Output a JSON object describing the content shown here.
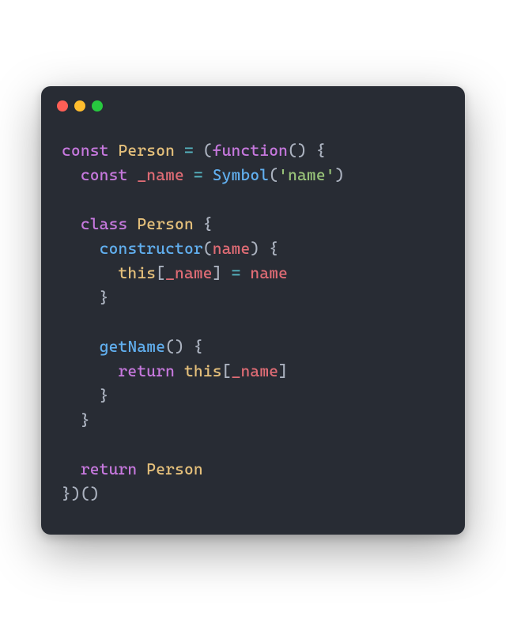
{
  "window": {
    "controls": {
      "close": "red",
      "minimize": "yellow",
      "zoom": "green"
    }
  },
  "code": {
    "tokens": [
      [
        {
          "t": "kw",
          "v": "const"
        },
        {
          "t": "pn",
          "v": " "
        },
        {
          "t": "cls",
          "v": "Person"
        },
        {
          "t": "pn",
          "v": " "
        },
        {
          "t": "op",
          "v": "="
        },
        {
          "t": "pn",
          "v": " ("
        },
        {
          "t": "kw",
          "v": "function"
        },
        {
          "t": "pn",
          "v": "() {"
        }
      ],
      [
        {
          "t": "pn",
          "v": "  "
        },
        {
          "t": "kw",
          "v": "const"
        },
        {
          "t": "pn",
          "v": " "
        },
        {
          "t": "var",
          "v": "_name"
        },
        {
          "t": "pn",
          "v": " "
        },
        {
          "t": "op",
          "v": "="
        },
        {
          "t": "pn",
          "v": " "
        },
        {
          "t": "fn",
          "v": "Symbol"
        },
        {
          "t": "pn",
          "v": "("
        },
        {
          "t": "str",
          "v": "'name'"
        },
        {
          "t": "pn",
          "v": ")"
        }
      ],
      [],
      [
        {
          "t": "pn",
          "v": "  "
        },
        {
          "t": "kw",
          "v": "class"
        },
        {
          "t": "pn",
          "v": " "
        },
        {
          "t": "cls",
          "v": "Person"
        },
        {
          "t": "pn",
          "v": " {"
        }
      ],
      [
        {
          "t": "pn",
          "v": "    "
        },
        {
          "t": "fn",
          "v": "constructor"
        },
        {
          "t": "pn",
          "v": "("
        },
        {
          "t": "var",
          "v": "name"
        },
        {
          "t": "pn",
          "v": ") {"
        }
      ],
      [
        {
          "t": "pn",
          "v": "      "
        },
        {
          "t": "this",
          "v": "this"
        },
        {
          "t": "pn",
          "v": "["
        },
        {
          "t": "var",
          "v": "_name"
        },
        {
          "t": "pn",
          "v": "] "
        },
        {
          "t": "op",
          "v": "="
        },
        {
          "t": "pn",
          "v": " "
        },
        {
          "t": "var",
          "v": "name"
        }
      ],
      [
        {
          "t": "pn",
          "v": "    }"
        }
      ],
      [],
      [
        {
          "t": "pn",
          "v": "    "
        },
        {
          "t": "fn",
          "v": "getName"
        },
        {
          "t": "pn",
          "v": "() {"
        }
      ],
      [
        {
          "t": "pn",
          "v": "      "
        },
        {
          "t": "kw",
          "v": "return"
        },
        {
          "t": "pn",
          "v": " "
        },
        {
          "t": "this",
          "v": "this"
        },
        {
          "t": "pn",
          "v": "["
        },
        {
          "t": "var",
          "v": "_name"
        },
        {
          "t": "pn",
          "v": "]"
        }
      ],
      [
        {
          "t": "pn",
          "v": "    }"
        }
      ],
      [
        {
          "t": "pn",
          "v": "  }"
        }
      ],
      [],
      [
        {
          "t": "pn",
          "v": "  "
        },
        {
          "t": "kw",
          "v": "return"
        },
        {
          "t": "pn",
          "v": " "
        },
        {
          "t": "cls",
          "v": "Person"
        }
      ],
      [
        {
          "t": "pn",
          "v": "})()"
        }
      ]
    ]
  },
  "colors": {
    "bg": "#282c34",
    "keyword": "#c678dd",
    "class": "#e5c07b",
    "operator": "#56b6c2",
    "function": "#61afef",
    "variable": "#e06c75",
    "string": "#98c379",
    "plain": "#abb2bf"
  }
}
